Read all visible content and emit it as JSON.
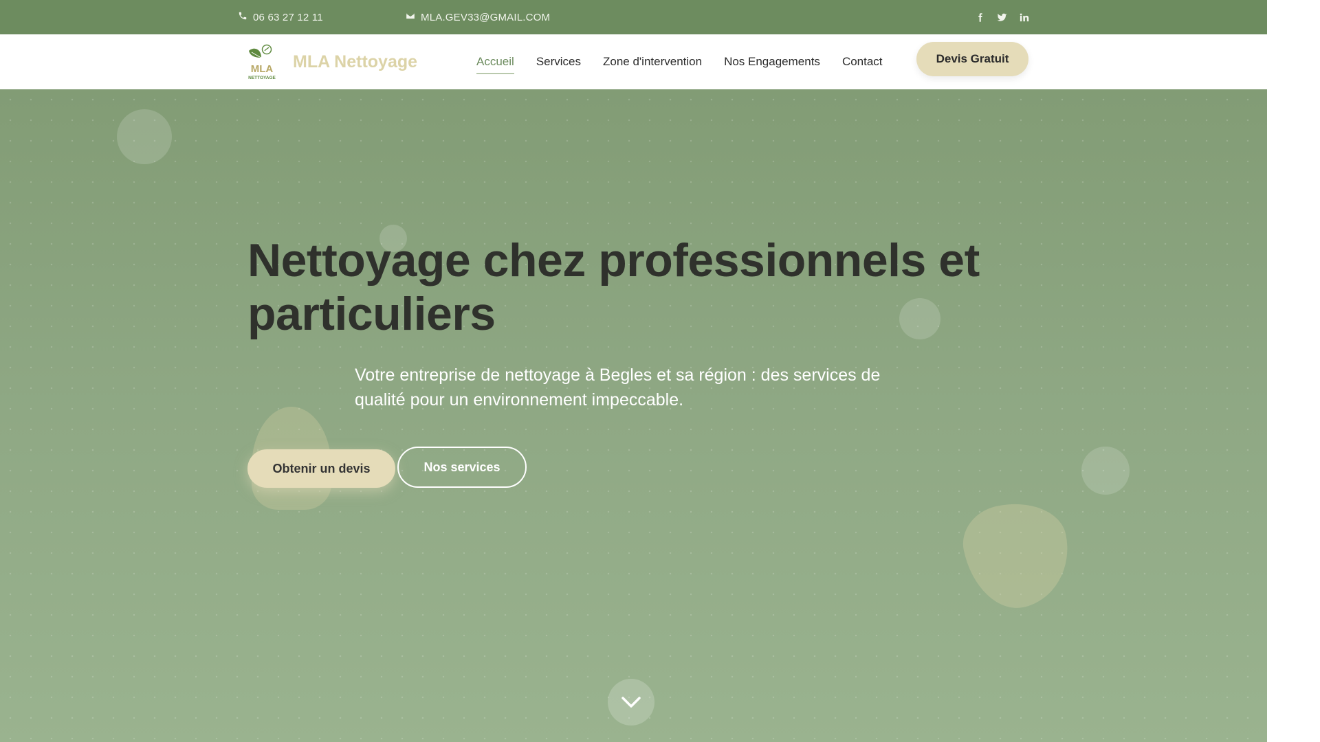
{
  "topbar": {
    "phone": "06 63 27 12 11",
    "email": "MLA.GEV33@GMAIL.COM",
    "socials": [
      "facebook-icon",
      "twitter-icon",
      "linkedin-icon"
    ]
  },
  "brand": {
    "logo_word": "MLA",
    "logo_sub": "NETTOYAGE",
    "name": "MLA Nettoyage"
  },
  "nav": {
    "items": [
      {
        "label": "Accueil",
        "active": true
      },
      {
        "label": "Services",
        "active": false
      },
      {
        "label": "Zone d'intervention",
        "active": false
      },
      {
        "label": "Nos Engagements",
        "active": false
      },
      {
        "label": "Contact",
        "active": false
      }
    ],
    "cta_label": "Devis Gratuit"
  },
  "hero": {
    "title": "Nettoyage chez professionnels et particuliers",
    "subtitle": "Votre entreprise de nettoyage à Begles et sa région : des services de qualité pour un environnement impeccable.",
    "primary_button": "Obtenir un devis",
    "secondary_button": "Nos services",
    "scroll_icon": "chevron-down-icon"
  },
  "colors": {
    "topbar": "#6d8c5f",
    "accent": "#6d8c5f",
    "cta": "#e5dcb9",
    "brand_text": "#dcd3a7",
    "hero_top": "#829c75",
    "hero_bottom": "#9ab38f"
  }
}
